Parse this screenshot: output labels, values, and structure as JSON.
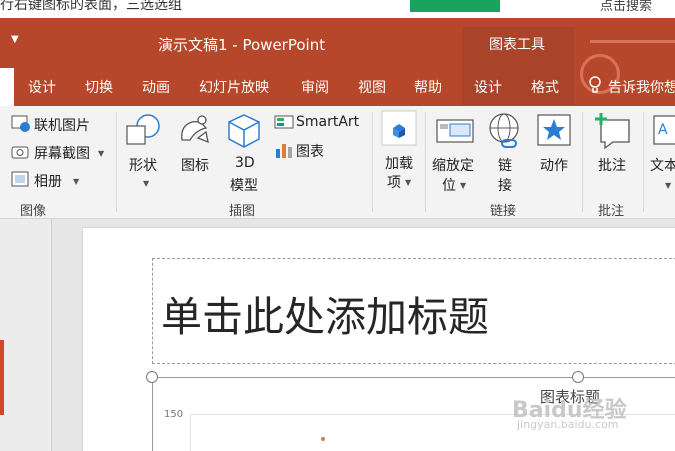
{
  "top_strip": {
    "text": "行右键图标的表面，三选选组",
    "button_label": "",
    "right_text": "点击搜索"
  },
  "title_bar": {
    "document_title": "演示文稿1  -  PowerPoint",
    "context_title": "图表工具"
  },
  "tabs": [
    {
      "label": "设计"
    },
    {
      "label": "切换"
    },
    {
      "label": "动画"
    },
    {
      "label": "幻灯片放映"
    },
    {
      "label": "审阅"
    },
    {
      "label": "视图"
    },
    {
      "label": "帮助"
    },
    {
      "label": "设计"
    },
    {
      "label": "格式"
    }
  ],
  "tell_me": "告诉我你想",
  "ribbon": {
    "images_group": {
      "online_pictures": "联机图片",
      "screenshot": "屏幕截图",
      "album": "相册",
      "label": "图像"
    },
    "illustrations_group": {
      "shapes": "形状",
      "icons": "图标",
      "model_3d_line1": "3D",
      "model_3d_line2": "模型",
      "smartart": "SmartArt",
      "chart": "图表",
      "label": "插图"
    },
    "addins_group": {
      "addins_line1": "加载",
      "addins_line2": "项"
    },
    "links_group": {
      "zoom_line1": "缩放定",
      "zoom_line2": "位",
      "link_line1": "链",
      "link_line2": "接",
      "action": "动作",
      "label": "链接"
    },
    "comments_group": {
      "comment": "批注",
      "label": "批注"
    },
    "text_group": {
      "textbox": "文本"
    }
  },
  "slide": {
    "title_placeholder": "单击此处添加标题",
    "chart_title": "图表标题",
    "y_axis_top_tick": "150"
  },
  "watermark": {
    "text": "Baidu经验",
    "sub": "jingyan.baidu.com"
  },
  "colors": {
    "ribbon_accent": "#b7472a",
    "context_band": "#a9432a",
    "ribbon_bg": "#f3f3f3"
  }
}
